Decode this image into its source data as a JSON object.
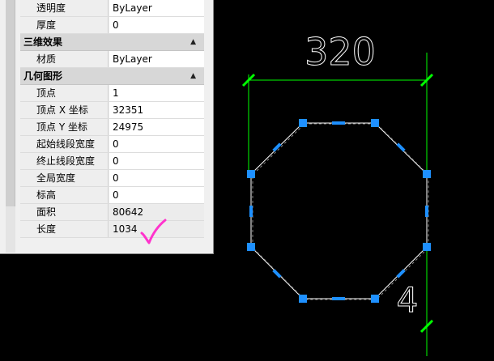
{
  "properties": {
    "top_rows": [
      {
        "label": "透明度",
        "value": "ByLayer"
      },
      {
        "label": "厚度",
        "value": "0"
      }
    ],
    "section_3d": {
      "title": "三维效果",
      "rows": [
        {
          "label": "材质",
          "value": "ByLayer"
        }
      ]
    },
    "section_geometry": {
      "title": "几何图形",
      "rows": [
        {
          "label": "顶点",
          "value": "1"
        },
        {
          "label": "顶点 X 坐标",
          "value": "32351"
        },
        {
          "label": "顶点 Y 坐标",
          "value": "24975"
        },
        {
          "label": "起始线段宽度",
          "value": "0"
        },
        {
          "label": "终止线段宽度",
          "value": "0"
        },
        {
          "label": "全局宽度",
          "value": "0"
        },
        {
          "label": "标高",
          "value": "0"
        },
        {
          "label": "面积",
          "value": "80642"
        },
        {
          "label": "长度",
          "value": "1034"
        }
      ]
    }
  },
  "drawing": {
    "dimension_text": "320",
    "side_dimension_text": "4"
  },
  "colors": {
    "dimension": "#00ff00",
    "grip": "#1e90ff",
    "annotation_check": "#ff33cc"
  }
}
